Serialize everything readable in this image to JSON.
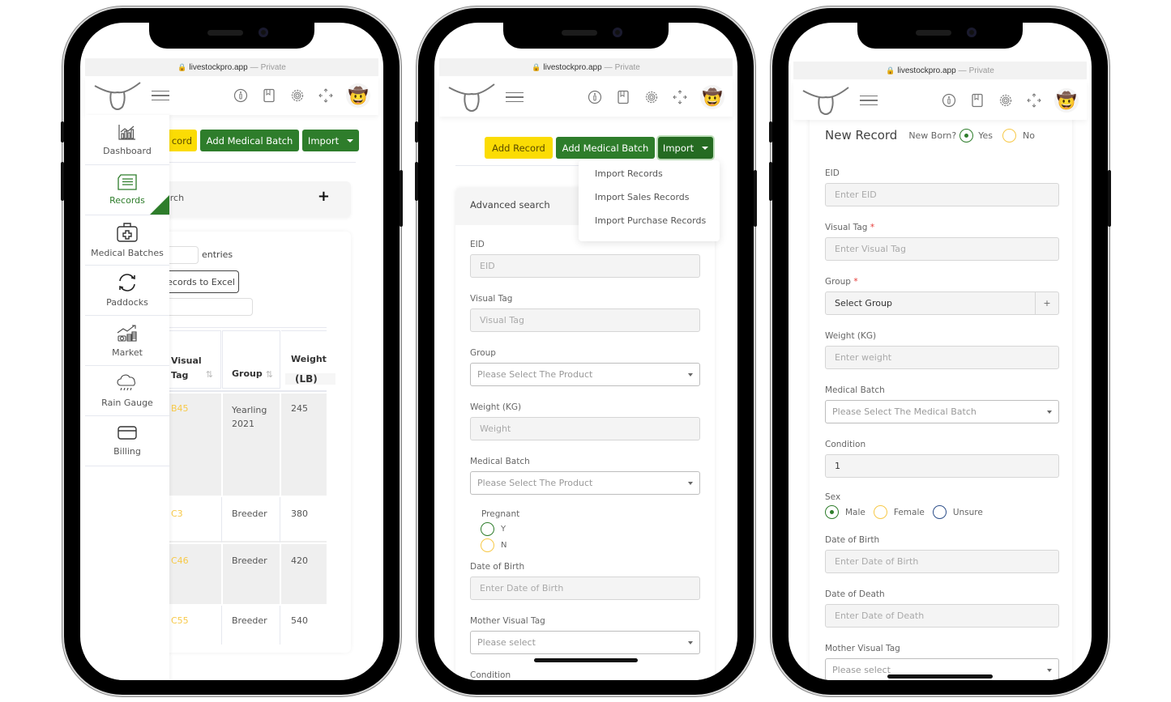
{
  "browser": {
    "domain": "livestockpro.app",
    "separator": "—",
    "mode": "Private"
  },
  "appbar": {
    "icons": [
      "info-icon",
      "book-icon",
      "gear-icon",
      "fullscreen-icon"
    ],
    "avatar": "🤠"
  },
  "toolbar": {
    "add_record": "Add Record",
    "add_record_cut": "cord",
    "add_medical_batch": "Add Medical Batch",
    "import": "Import"
  },
  "phone1": {
    "sidebar": [
      {
        "label": "Dashboard",
        "icon": "chart-icon",
        "active": false
      },
      {
        "label": "Records",
        "icon": "records-icon",
        "active": true
      },
      {
        "label": "Medical Batches",
        "icon": "medical-kit-icon",
        "active": false
      },
      {
        "label": "Paddocks",
        "icon": "rotate-icon",
        "active": false
      },
      {
        "label": "Market",
        "icon": "market-icon",
        "active": false
      },
      {
        "label": "Rain Gauge",
        "icon": "rain-cloud-icon",
        "active": false
      },
      {
        "label": "Billing",
        "icon": "card-icon",
        "active": false
      }
    ],
    "search_label_cut": "arch",
    "search_toggle": "+",
    "entries_label": "entries",
    "export_label_cut": "Records to Excel",
    "table": {
      "headers": [
        "Visual Tag",
        "Group",
        "Weight (LB)"
      ],
      "header_lines": [
        [
          "Visual",
          "Tag"
        ],
        [
          "Group"
        ],
        [
          "Weight",
          "(LB)"
        ]
      ],
      "sort_icon": "⇅",
      "rows": [
        {
          "tag": "B45",
          "group": "Yearling 2021",
          "group_lines": [
            "Yearling",
            "2021"
          ],
          "weight": "245"
        },
        {
          "tag": "C3",
          "group": "Breeder",
          "group_lines": [
            "Breeder"
          ],
          "weight": "380"
        },
        {
          "tag": "C46",
          "group": "Breeder",
          "group_lines": [
            "Breeder"
          ],
          "weight": "420"
        },
        {
          "tag": "C55",
          "group": "Breeder",
          "group_lines": [
            "Breeder"
          ],
          "weight": "540"
        }
      ]
    }
  },
  "phone2": {
    "import_menu": [
      "Import Records",
      "Import Sales Records",
      "Import Purchase Records"
    ],
    "advanced_search": "Advanced search",
    "fields": {
      "eid": {
        "label": "EID",
        "placeholder": "EID"
      },
      "visual_tag": {
        "label": "Visual Tag",
        "placeholder": "Visual Tag"
      },
      "group": {
        "label": "Group",
        "value": "Please Select The Product"
      },
      "weight": {
        "label": "Weight (KG)",
        "placeholder": "Weight"
      },
      "medical_batch": {
        "label": "Medical Batch",
        "value": "Please Select The Product"
      },
      "pregnant": {
        "label": "Pregnant",
        "options": [
          "Y",
          "N"
        ]
      },
      "dob": {
        "label": "Date of Birth",
        "placeholder": "Enter Date of Birth"
      },
      "mother": {
        "label": "Mother Visual Tag",
        "value": "Please select"
      },
      "condition": {
        "label": "Condition"
      }
    }
  },
  "phone3": {
    "title": "New Record",
    "new_born_label": "New Born?",
    "new_born_options": [
      "Yes",
      "No"
    ],
    "new_born_selected": "Yes",
    "fields": {
      "eid": {
        "label": "EID",
        "placeholder": "Enter EID"
      },
      "visual_tag": {
        "label": "Visual Tag",
        "required": "*",
        "placeholder": "Enter Visual Tag"
      },
      "group": {
        "label": "Group",
        "required": "*",
        "value": "Select Group",
        "add": "+"
      },
      "weight": {
        "label": "Weight (KG)",
        "placeholder": "Enter weight"
      },
      "medical_batch": {
        "label": "Medical Batch",
        "value": "Please Select The Medical Batch"
      },
      "condition": {
        "label": "Condition",
        "value": "1"
      },
      "sex": {
        "label": "Sex",
        "options": [
          "Male",
          "Female",
          "Unsure"
        ],
        "selected": "Male"
      },
      "dob": {
        "label": "Date of Birth",
        "placeholder": "Enter Date of Birth"
      },
      "dod": {
        "label": "Date of Death",
        "placeholder": "Enter Date of Death"
      },
      "mother": {
        "label": "Mother Visual Tag",
        "value": "Please select"
      }
    }
  },
  "colors": {
    "green": "#2e7d2b",
    "yellow": "#fbdc04",
    "tag_yellow": "#f7c948",
    "unsure_blue": "#2d4f8a",
    "required_red": "#e53935"
  }
}
